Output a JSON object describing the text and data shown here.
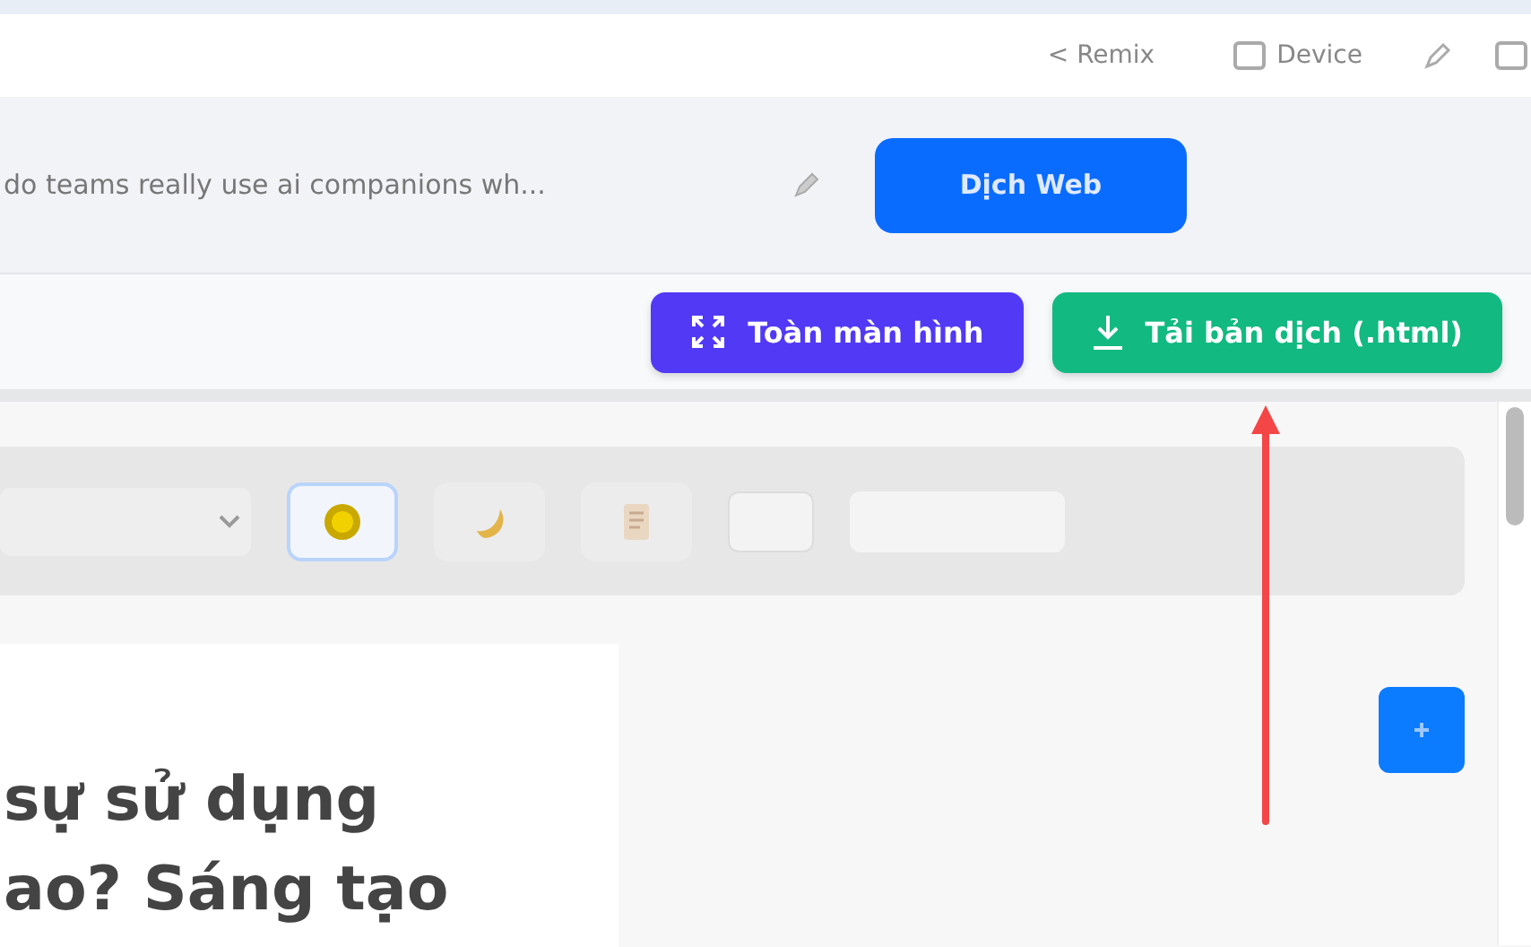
{
  "header": {
    "back_link": "< Remix",
    "device_button": "Device"
  },
  "url_bar": {
    "value": "do teams really use ai companions wh...",
    "translate_button": "Dịch Web"
  },
  "action_bar": {
    "buttons": [
      {
        "kind": "fullscreen",
        "label": "Toàn màn hình"
      },
      {
        "kind": "download",
        "label": "Tải bản dịch (.html)"
      }
    ]
  },
  "reader_toolbar": {
    "themes": [
      {
        "kind": "sun",
        "selected": true
      },
      {
        "kind": "moon",
        "selected": false
      },
      {
        "kind": "scroll",
        "selected": false
      }
    ]
  },
  "article": {
    "heading_lines": [
      "sự sử dụng",
      "ao? Sáng tạo"
    ]
  },
  "annotation": {
    "kind": "arrow"
  }
}
